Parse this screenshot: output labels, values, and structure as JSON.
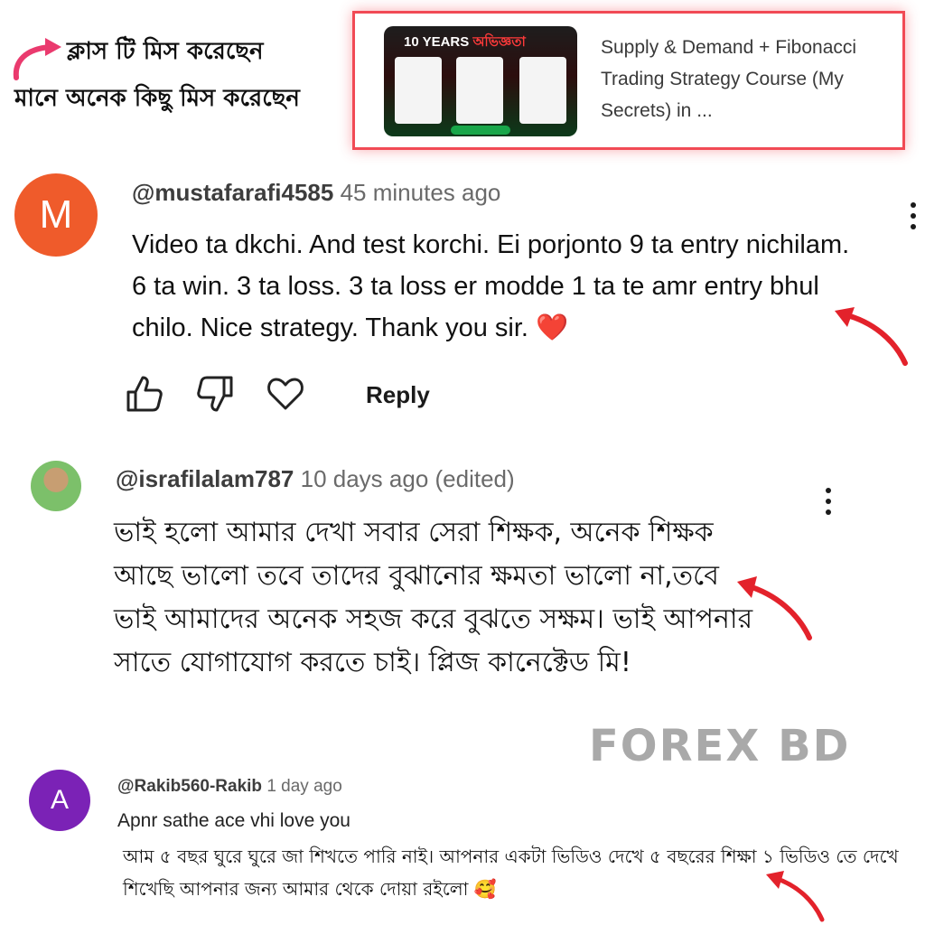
{
  "promo": {
    "line1": "ক্লাস টি মিস করেছেন",
    "line2": "মানে অনেক কিছু মিস করেছেন"
  },
  "course_card": {
    "thumbnail_title_prefix": "10 YEARS",
    "thumbnail_title_accent": "অভিজ্ঞতা",
    "title": "Supply & Demand + Fibonacci Trading Strategy Course (My Secrets) in ..."
  },
  "comments": [
    {
      "avatar_letter": "M",
      "avatar_color": "#ef5b2b",
      "handle": "@mustafarafi4585",
      "time": "45 minutes ago",
      "body": "Video ta dkchi. And test korchi. Ei porjonto 9 ta entry nichilam. 6 ta win. 3 ta loss. 3 ta loss er modde 1 ta te amr entry bhul chilo. Nice strategy. Thank you sir.",
      "emoji": "❤️"
    },
    {
      "handle": "@israfilalam787",
      "time": "10 days ago (edited)",
      "body": "ভাই হলো আমার দেখা সবার সেরা শিক্ষক, অনেক শিক্ষক আছে ভালো তবে তাদের বুঝানোর ক্ষমতা ভালো না,তবে ভাই আমাদের অনেক সহজ করে বুঝতে সক্ষম। ভাই আপনার সাতে যোগাযোগ করতে চাই। প্লিজ কানেক্টেড মি!"
    },
    {
      "avatar_letter": "A",
      "avatar_color": "#7b22b6",
      "handle": "@Rakib560-Rakib",
      "time": "1 day ago",
      "line1": "Apnr sathe ace vhi love you",
      "body": "আম ৫ বছর ঘুরে ঘুরে জা শিখতে পারি নাই। আপনার একটা ভিডিও দেখে ৫ বছরের শিক্ষা ১ ভিডিও তে দেখে শিখেছি আপনার জন্য আমার থেকে দোয়া রইলো",
      "emoji": "🥰"
    }
  ],
  "actions": {
    "reply_label": "Reply",
    "icons": [
      "thumbs-up-icon",
      "thumbs-down-icon",
      "heart-outline-icon"
    ]
  },
  "watermark": "FOREX BD",
  "accent_color": "#e3222b"
}
